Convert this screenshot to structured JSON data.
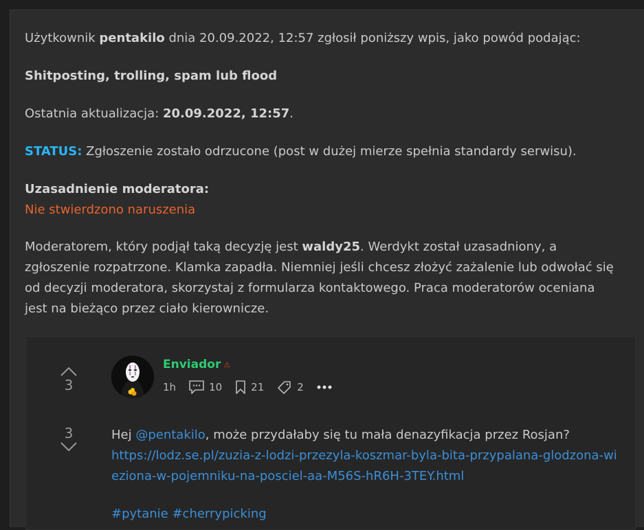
{
  "report": {
    "intro_prefix": "Użytkownik ",
    "reporter": "pentakilo",
    "intro_suffix": " dnia 20.09.2022, 12:57 zgłosił poniższy wpis, jako powód podając:",
    "reason": "Shitposting, trolling, spam lub flood",
    "update_label": "Ostatnia aktualizacja: ",
    "update_value": "20.09.2022, 12:57",
    "update_end": ".",
    "status_label": "STATUS:",
    "status_text": " Zgłoszenie zostało odrzucone (post w dużej mierze spełnia standardy serwisu).",
    "justification_label": "Uzasadnienie moderatora:",
    "justification_text": "Nie stwierdzono naruszenia",
    "mod_prefix": "Moderatorem, który podjął taką decyzję jest ",
    "moderator": "waldy25",
    "mod_suffix": ". Werdykt został uzasadniony, a zgłoszenie rozpatrzone. Klamka zapadła. Niemniej jeśli chcesz złożyć zażalenie lub odwołać się od decyzji moderatora, skorzystaj z formularza kontaktowego. Praca moderatorów oceniana jest na bieżąco przez ciało kierownicze."
  },
  "comment": {
    "upvotes": "3",
    "downvotes": "3",
    "author": "Enviador",
    "author_mark": "⚠",
    "time": "1h",
    "comments_count": "10",
    "bookmarks_count": "21",
    "tags_count": "2",
    "body_prefix": "Hej ",
    "mention": "@pentakilo",
    "body_suffix": ", może przydałaby się tu mała denazyfikacja przez Rosjan?",
    "link": "https://lodz.se.pl/zuzia-z-lodzi-przezyla-koszmar-byla-bita-przypalana-glodzona-wieziona-w-pojemniku-na-posciel-aa-M56S-hR6H-3TEY.html",
    "tag1": "#pytanie",
    "tag2": "#cherrypicking"
  },
  "colors": {
    "status": "#29b6f6",
    "verdict": "#e8642f",
    "author": "#2ecc71",
    "link": "#3b8fd8"
  }
}
